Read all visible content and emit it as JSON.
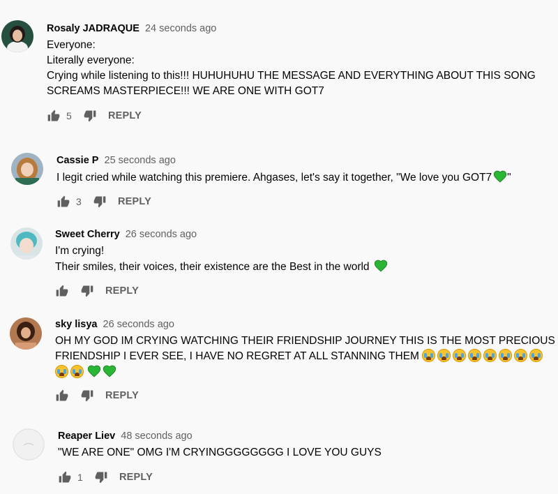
{
  "reply_label": "REPLY",
  "colors": {
    "heart": "#2bb534",
    "icon": "#606060"
  },
  "comments": [
    {
      "author": "Rosaly JADRAQUE",
      "time": "24 seconds ago",
      "lines": [
        "Everyone:",
        "Literally everyone:",
        "Crying while listening to this!!! HUHUHUHU THE MESSAGE AND EVERYTHING ABOUT THIS SONG",
        "SCREAMS MASTERPIECE!!! WE ARE ONE WITH GOT7"
      ],
      "likes": "5"
    },
    {
      "author": "Cassie P",
      "time": "25 seconds ago",
      "lines": [
        "I legit cried while watching this premiere. Ahgases, let's say it together, \"We love you GOT7",
        "\""
      ],
      "likes": "3"
    },
    {
      "author": "Sweet Cherry",
      "time": "26 seconds ago",
      "lines": [
        "I'm crying!",
        "Their smiles, their voices, their existence are the Best in the world"
      ],
      "likes": ""
    },
    {
      "author": "sky lisya",
      "time": "26 seconds ago",
      "lines": [
        "OH MY GOD IM CRYING WATCHING THEIR FRIENDSHIP JOURNEY THIS IS THE MOST PRECIOUS",
        "FRIENDSHIP I EVER SEE,  I HAVE NO REGRET AT ALL STANNING THEM"
      ],
      "likes": ""
    },
    {
      "author": "Reaper Liev",
      "time": "48 seconds ago",
      "lines": [
        "\"WE ARE ONE\" OMG I'M CRYINGGGGGGGG I LOVE YOU GUYS"
      ],
      "likes": "1"
    }
  ]
}
